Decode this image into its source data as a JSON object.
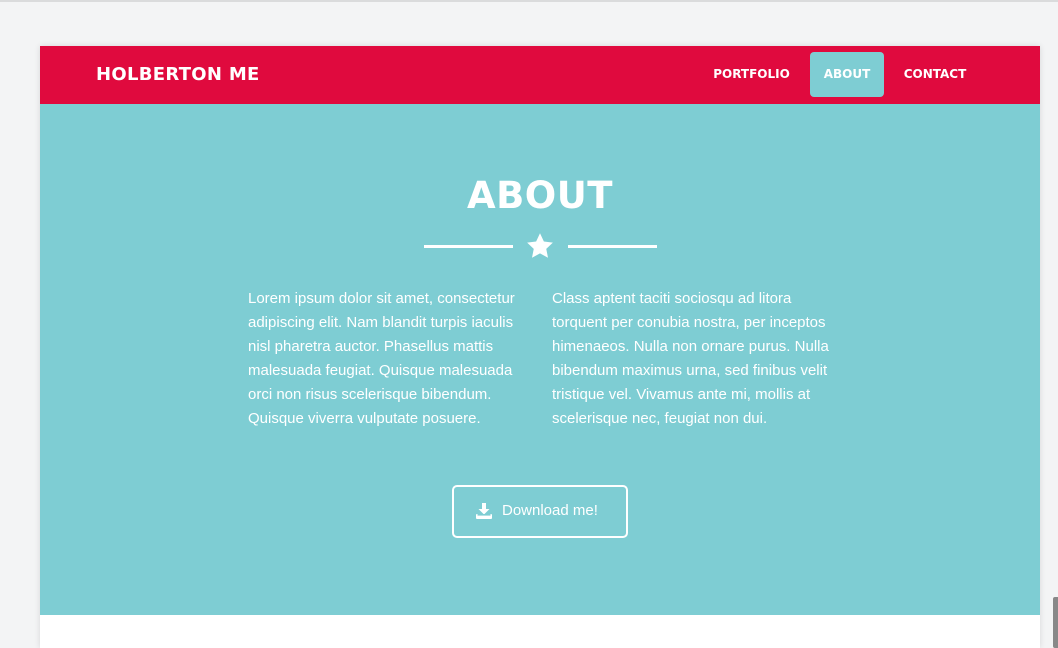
{
  "navbar": {
    "brand": "HOLBERTON ME",
    "items": [
      {
        "label": "PORTFOLIO",
        "active": false
      },
      {
        "label": "ABOUT",
        "active": true
      },
      {
        "label": "CONTACT",
        "active": false
      }
    ]
  },
  "about": {
    "title": "ABOUT",
    "divider_icon": "star-icon",
    "columns": [
      "Lorem ipsum dolor sit amet, consectetur adipiscing elit. Nam blandit turpis iaculis nisl pharetra auctor. Phasellus mattis malesuada feugiat. Quisque malesuada orci non risus scelerisque bibendum. Quisque viverra vulputate posuere.",
      "Class aptent taciti sociosqu ad litora torquent per conubia nostra, per inceptos himenaeos. Nulla non ornare purus. Nulla bibendum maximus urna, sed finibus velit tristique vel. Vivamus ante mi, mollis at scelerisque nec, feugiat non dui."
    ],
    "download_button": {
      "label": "Download me!",
      "icon": "download-icon"
    }
  },
  "colors": {
    "navbar_bg": "#e00a3e",
    "section_bg": "#7ecdd3",
    "text": "#ffffff"
  }
}
